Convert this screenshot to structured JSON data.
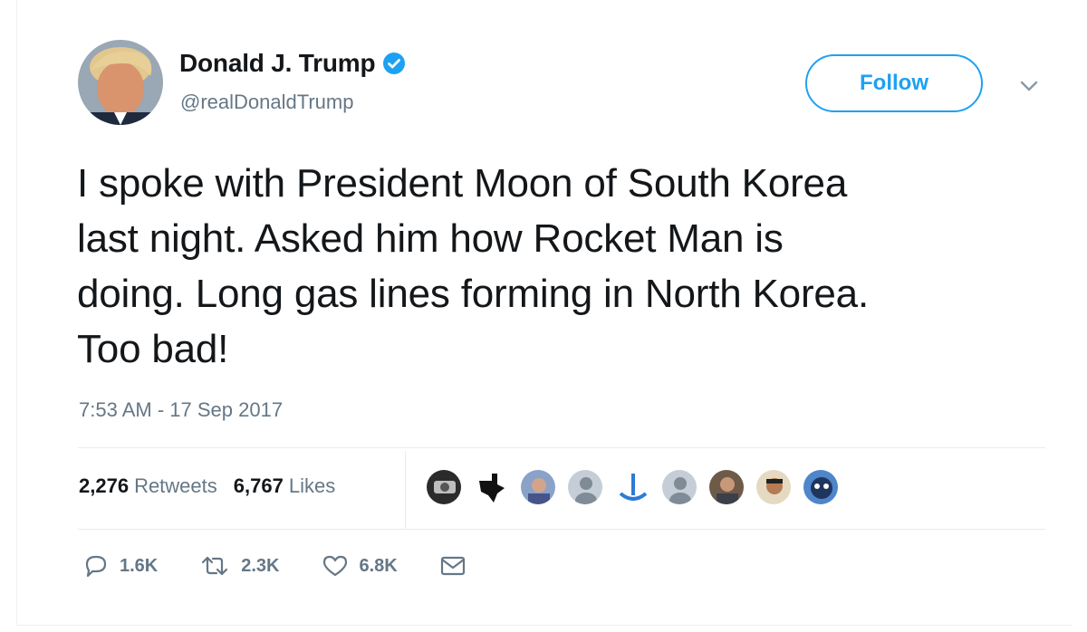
{
  "author": {
    "name": "Donald J. Trump",
    "handle": "@realDonaldTrump",
    "verified": true
  },
  "follow_label": "Follow",
  "tweet": {
    "lines": [
      "I spoke with President Moon of South Korea",
      "last night. Asked him how Rocket Man is",
      "doing. Long gas lines forming in North Korea.",
      "Too bad!"
    ]
  },
  "timestamp": "7:53 AM - 17 Sep 2017",
  "stats": {
    "retweets_count": "2,276",
    "retweets_label": "Retweets",
    "likes_count": "6,767",
    "likes_label": "Likes"
  },
  "actions": {
    "replies": "1.6K",
    "retweets": "2.3K",
    "likes": "6.8K"
  },
  "colors": {
    "accent": "#1da1f2",
    "text": "#14171a",
    "muted": "#657786"
  },
  "icons": [
    "verified-badge-icon",
    "chevron-down-icon",
    "reply-icon",
    "retweet-icon",
    "like-icon",
    "message-icon"
  ]
}
